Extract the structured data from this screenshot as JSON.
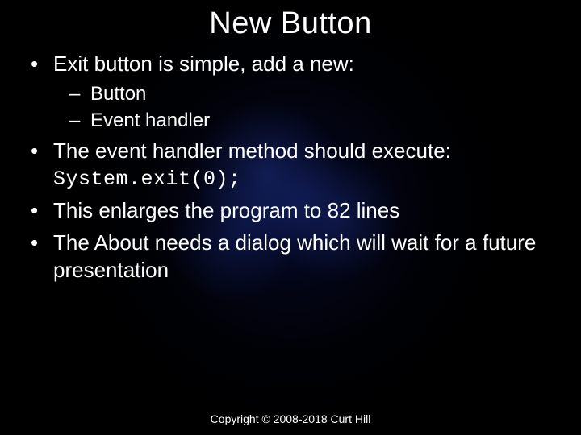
{
  "title": "New Button",
  "bullets": {
    "b1": "Exit button is simple, add a new:",
    "b1_sub": {
      "s1": "Button",
      "s2": "Event handler"
    },
    "b2": "The event handler method should execute:",
    "b2_code": "System.exit(0);",
    "b3": "This enlarges the program to 82 lines",
    "b4": "The About needs a dialog which will wait for a future presentation"
  },
  "footer": "Copyright © 2008-2018 Curt Hill"
}
